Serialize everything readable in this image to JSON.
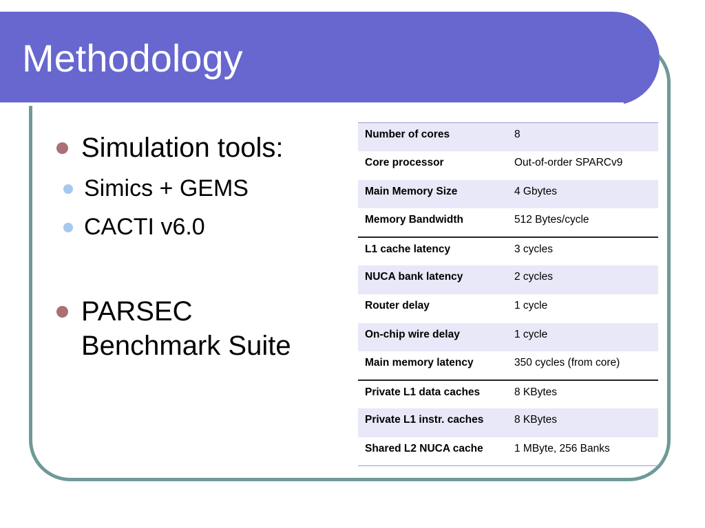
{
  "slide": {
    "title": "Methodology",
    "bullets": [
      {
        "text": "Simulation tools:",
        "sub": [
          "Simics + GEMS",
          "CACTI v6.0"
        ]
      },
      {
        "text_lines": [
          "PARSEC",
          "Benchmark Suite"
        ]
      }
    ]
  },
  "table": {
    "rows": [
      {
        "key": "Number of cores",
        "value": "8"
      },
      {
        "key": "Core processor",
        "value": "Out-of-order SPARCv9"
      },
      {
        "key": "Main Memory Size",
        "value": "4 Gbytes"
      },
      {
        "key": "Memory Bandwidth",
        "value": "512 Bytes/cycle"
      },
      {
        "key": "L1 cache latency",
        "value": "3 cycles"
      },
      {
        "key": "NUCA bank latency",
        "value": "2 cycles"
      },
      {
        "key": "Router delay",
        "value": "1 cycle"
      },
      {
        "key": "On-chip wire delay",
        "value": "1 cycle"
      },
      {
        "key": "Main memory latency",
        "value": "350 cycles (from core)"
      },
      {
        "key": "Private L1 data caches",
        "value": "8 KBytes"
      },
      {
        "key": "Private L1 instr. caches",
        "value": "8 KBytes"
      },
      {
        "key": "Shared L2 NUCA cache",
        "value": "1 MByte, 256 Banks"
      }
    ]
  },
  "colors": {
    "title_bar": "#6767cf",
    "frame": "#6e9a97",
    "bullet_l1": "#a97076",
    "bullet_l2": "#a6c8f0",
    "row_shade": "#e8e8f8"
  }
}
